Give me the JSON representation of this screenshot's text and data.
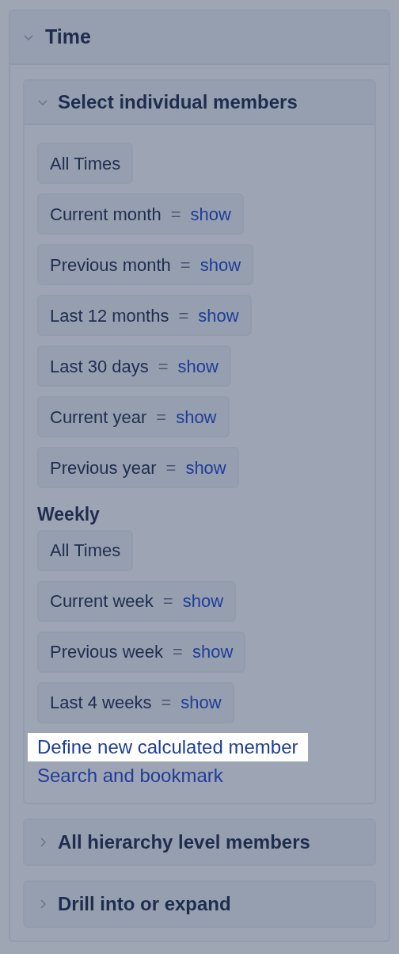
{
  "panel": {
    "title": "Time",
    "expanded": true,
    "sections": [
      {
        "title": "Select individual members",
        "expanded": true,
        "groups": [
          {
            "items": [
              {
                "label": "All Times"
              },
              {
                "label": "Current month",
                "separator": "=",
                "action": "show"
              },
              {
                "label": "Previous month",
                "separator": "=",
                "action": "show"
              },
              {
                "label": "Last 12 months",
                "separator": "=",
                "action": "show"
              },
              {
                "label": "Last 30 days",
                "separator": "=",
                "action": "show"
              },
              {
                "label": "Current year",
                "separator": "=",
                "action": "show"
              },
              {
                "label": "Previous year",
                "separator": "=",
                "action": "show"
              }
            ]
          },
          {
            "heading": "Weekly",
            "items": [
              {
                "label": "All Times"
              },
              {
                "label": "Current week",
                "separator": "=",
                "action": "show"
              },
              {
                "label": "Previous week",
                "separator": "=",
                "action": "show"
              },
              {
                "label": "Last 4 weeks",
                "separator": "=",
                "action": "show"
              }
            ]
          }
        ],
        "links": [
          {
            "label": "Define new calculated member",
            "highlighted": true
          },
          {
            "label": "Search and bookmark",
            "highlighted": false
          }
        ]
      },
      {
        "title": "All hierarchy level members",
        "expanded": false
      },
      {
        "title": "Drill into or expand",
        "expanded": false
      }
    ]
  }
}
